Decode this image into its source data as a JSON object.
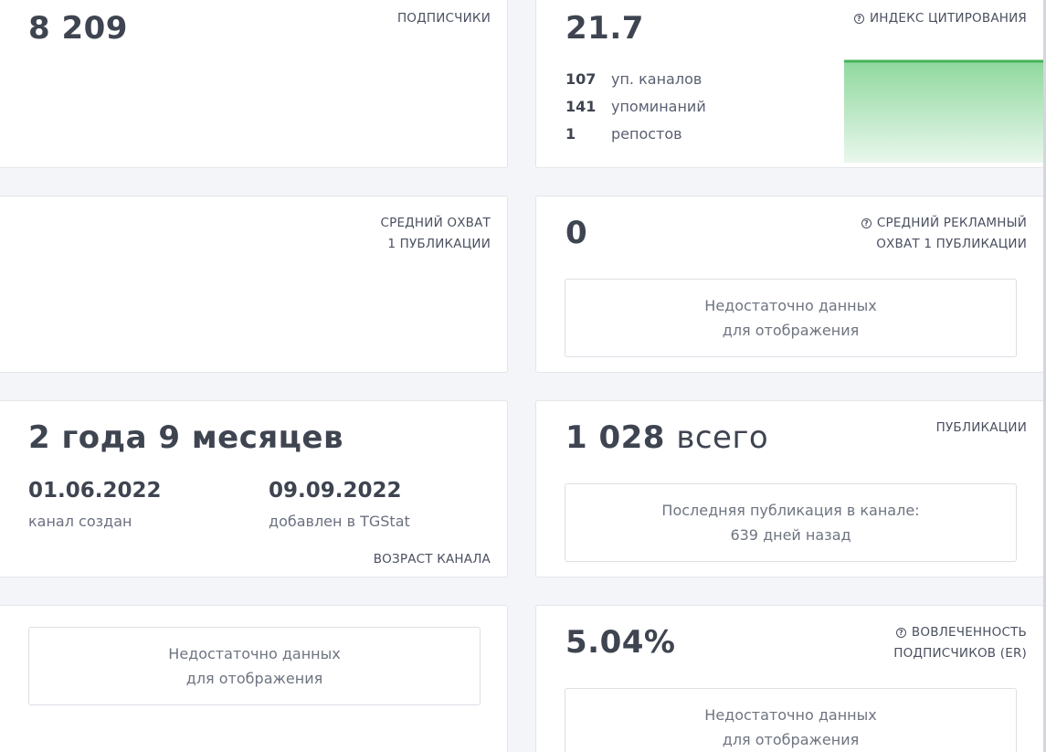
{
  "subscribers": {
    "value": "8 209",
    "label": "ПОДПИСЧИКИ"
  },
  "citation": {
    "value": "21.7",
    "label": "ИНДЕКС ЦИТИРОВАНИЯ",
    "stats": [
      {
        "num": "107",
        "text": "уп. каналов"
      },
      {
        "num": "141",
        "text": "упоминаний"
      },
      {
        "num": "1",
        "text": "репостов"
      }
    ]
  },
  "avg_reach": {
    "label_line1": "СРЕДНИЙ ОХВАТ",
    "label_line2": "1 ПУБЛИКАЦИИ"
  },
  "ad_reach": {
    "value": "0",
    "label_line1": "СРЕДНИЙ РЕКЛАМНЫЙ",
    "label_line2": "ОХВАТ 1 ПУБЛИКАЦИИ",
    "nodata_line1": "Недостаточно данных",
    "nodata_line2": "для отображения"
  },
  "age": {
    "value": "2 года 9 месяцев",
    "created_date": "01.06.2022",
    "created_label": "канал создан",
    "added_date": "09.09.2022",
    "added_label": "добавлен в TGStat",
    "label": "ВОЗРАСТ КАНАЛА"
  },
  "publications": {
    "value": "1 028",
    "suffix": "всего",
    "label": "ПУБЛИКАЦИИ",
    "last_line1": "Последняя публикация в канале:",
    "last_line2": "639 дней назад"
  },
  "bottom_left": {
    "nodata_line1": "Недостаточно данных",
    "nodata_line2": "для отображения"
  },
  "er": {
    "value": "5.04%",
    "label_line1": "ВОВЛЕЧЕННОСТЬ",
    "label_line2": "ПОДПИСЧИКОВ (ER)",
    "nodata_line1": "Недостаточно данных",
    "nodata_line2": "для отображения"
  },
  "colors": {
    "accent_green": "#4cbb5e",
    "text_dark": "#3e4450"
  },
  "icons": {
    "help": "question-circle-icon"
  }
}
